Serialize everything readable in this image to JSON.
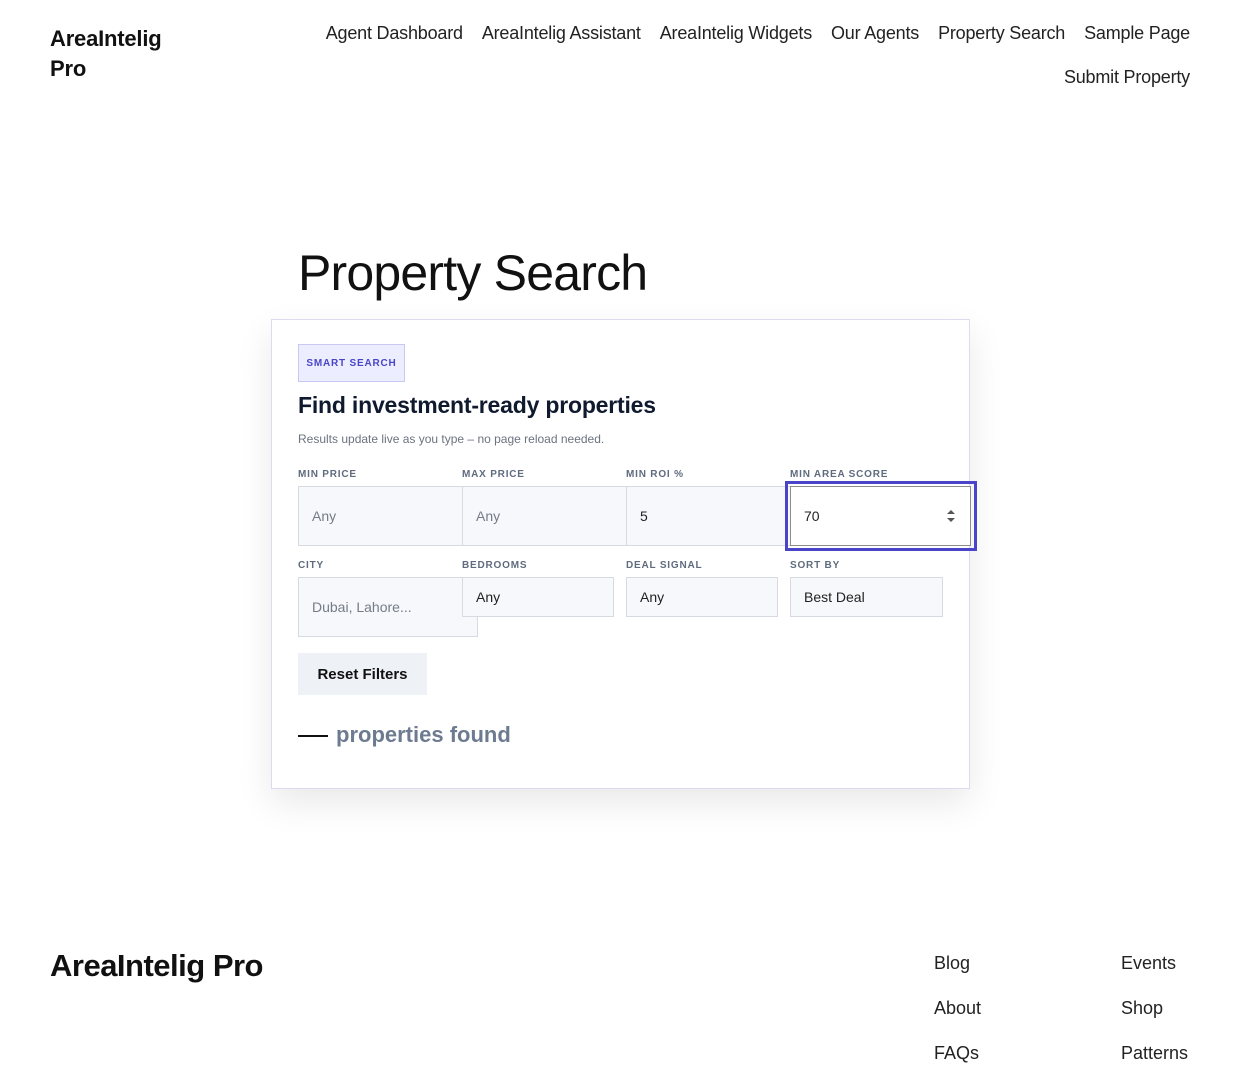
{
  "site": {
    "title": "AreaIntelig Pro"
  },
  "nav": {
    "items": [
      "Agent Dashboard",
      "AreaIntelig Assistant",
      "AreaIntelig Widgets",
      "Our Agents",
      "Property Search",
      "Sample Page",
      "Submit Property"
    ]
  },
  "page": {
    "title": "Property Search"
  },
  "search": {
    "badge": "SMART SEARCH",
    "heading": "Find investment-ready properties",
    "subtext": "Results update live as you type – no page reload needed.",
    "fields": {
      "min_price": {
        "label": "MIN PRICE",
        "placeholder": "Any",
        "value": ""
      },
      "max_price": {
        "label": "MAX PRICE",
        "placeholder": "Any",
        "value": ""
      },
      "min_roi": {
        "label": "MIN ROI %",
        "value": "5"
      },
      "min_area_score": {
        "label": "MIN AREA SCORE",
        "value": "70"
      },
      "city": {
        "label": "CITY",
        "placeholder": "Dubai, Lahore..."
      },
      "bedrooms": {
        "label": "BEDROOMS",
        "value": "Any"
      },
      "deal_signal": {
        "label": "DEAL SIGNAL",
        "value": "Any"
      },
      "sort_by": {
        "label": "SORT BY",
        "value": "Best Deal"
      }
    },
    "reset_label": "Reset Filters",
    "results_text": "properties found"
  },
  "footer": {
    "title": "AreaIntelig Pro",
    "col1": [
      "Blog",
      "About",
      "FAQs"
    ],
    "col2": [
      "Events",
      "Shop",
      "Patterns"
    ]
  },
  "colors": {
    "accent": "#4a45c8",
    "badge_bg": "#eceeff",
    "muted": "#6d7b90"
  },
  "icons": {
    "number_spinner": "spinner-arrows-icon"
  }
}
